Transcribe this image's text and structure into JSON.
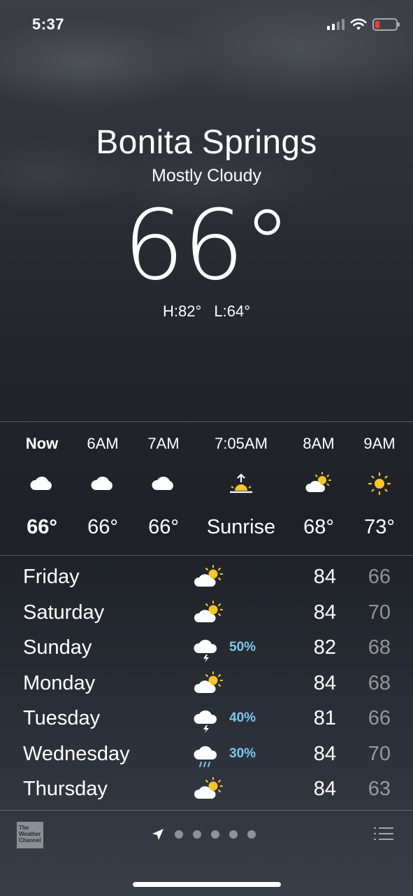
{
  "status_bar": {
    "time": "5:37"
  },
  "location": {
    "city": "Bonita Springs",
    "condition": "Mostly Cloudy",
    "temperature": "66°",
    "high": "H:82°",
    "low": "L:64°"
  },
  "hourly": [
    {
      "time": "Now",
      "icon": "cloud-icon",
      "temp": "66°"
    },
    {
      "time": "6AM",
      "icon": "cloud-icon",
      "temp": "66°"
    },
    {
      "time": "7AM",
      "icon": "cloud-icon",
      "temp": "66°"
    },
    {
      "time": "7:05AM",
      "icon": "sunrise-icon",
      "temp": "Sunrise"
    },
    {
      "time": "8AM",
      "icon": "partly-sunny-icon",
      "temp": "68°"
    },
    {
      "time": "9AM",
      "icon": "sun-icon",
      "temp": "73°"
    }
  ],
  "daily": [
    {
      "day": "Friday",
      "icon": "partly-sunny-icon",
      "pop": "",
      "high": "84",
      "low": "66"
    },
    {
      "day": "Saturday",
      "icon": "partly-sunny-icon",
      "pop": "",
      "high": "84",
      "low": "70"
    },
    {
      "day": "Sunday",
      "icon": "thunderstorm-icon",
      "pop": "50%",
      "high": "82",
      "low": "68"
    },
    {
      "day": "Monday",
      "icon": "partly-sunny-icon",
      "pop": "",
      "high": "84",
      "low": "68"
    },
    {
      "day": "Tuesday",
      "icon": "thunderstorm-icon",
      "pop": "40%",
      "high": "81",
      "low": "66"
    },
    {
      "day": "Wednesday",
      "icon": "rain-icon",
      "pop": "30%",
      "high": "84",
      "low": "70"
    },
    {
      "day": "Thursday",
      "icon": "partly-sunny-icon",
      "pop": "",
      "high": "84",
      "low": "63"
    }
  ],
  "footer": {
    "logo_text": "The Weather Channel",
    "page_count": 5
  },
  "colors": {
    "precip": "#7cc7ee",
    "sun": "#f7c42a",
    "battery_low": "#ff3b30"
  }
}
